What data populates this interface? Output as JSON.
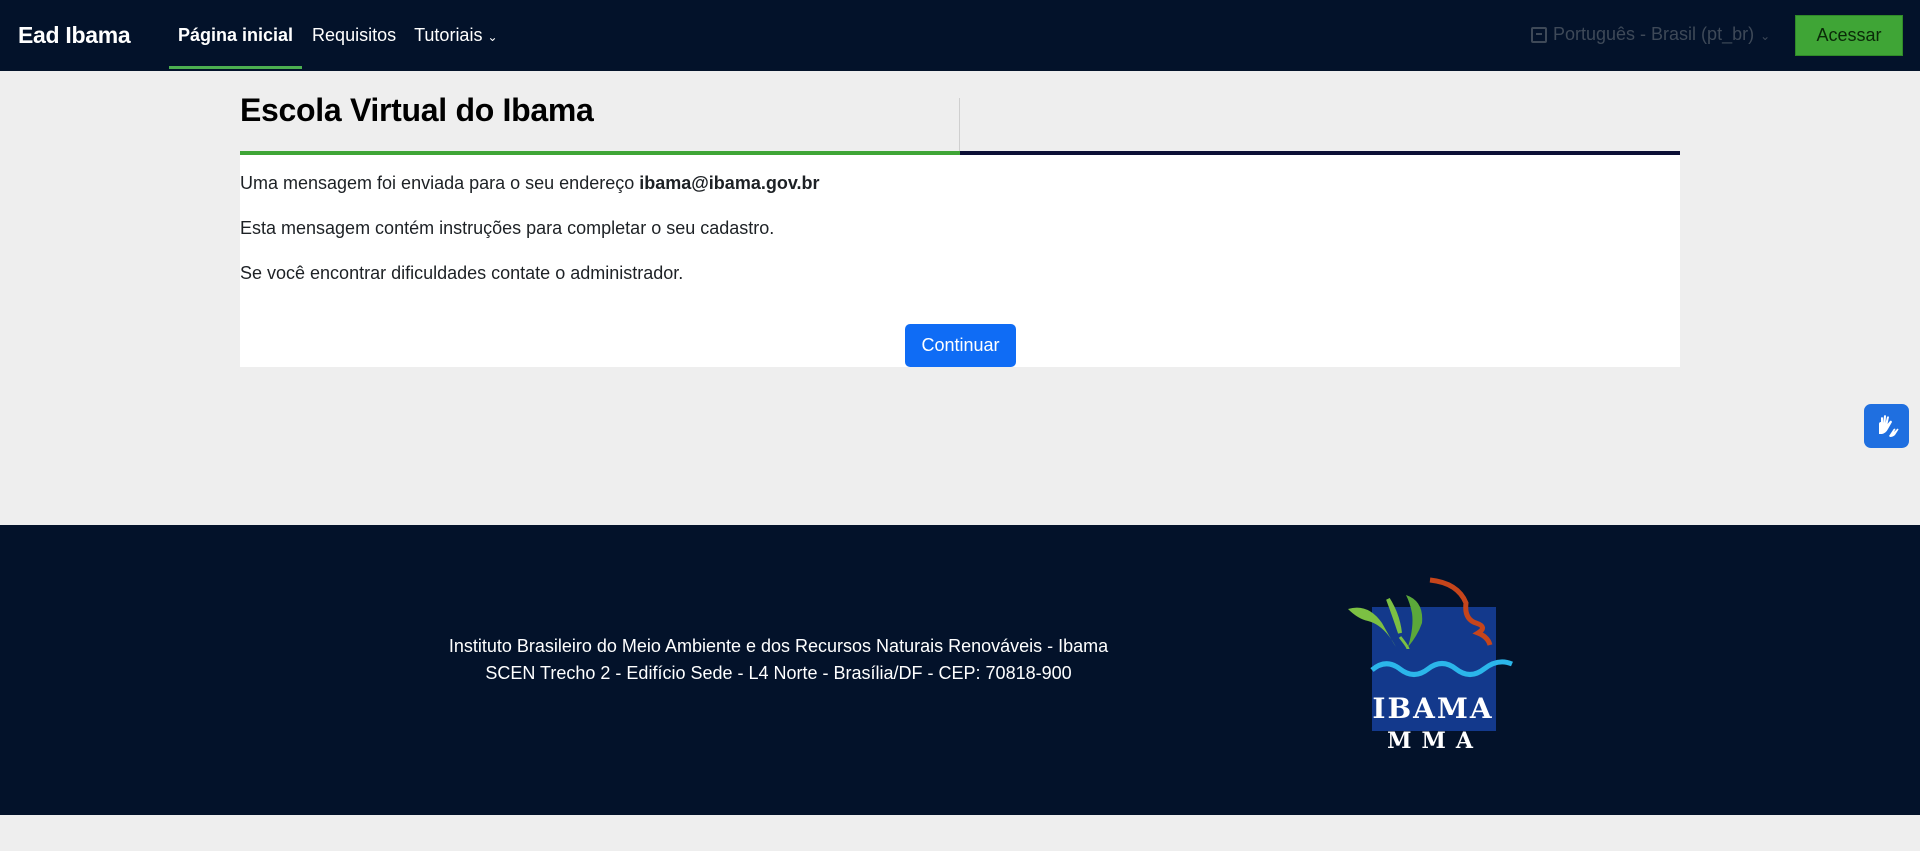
{
  "navbar": {
    "brand": "Ead Ibama",
    "items": [
      {
        "label": "Página inicial",
        "active": true
      },
      {
        "label": "Requisitos"
      },
      {
        "label": "Tutoriais",
        "has_dropdown": true
      }
    ],
    "language": "Português - Brasil (pt_br)",
    "login_label": "Acessar",
    "login_color": "#3fa536"
  },
  "page": {
    "title": "Escola Virtual do Ibama",
    "messages": [
      {
        "text": "Uma mensagem foi enviada para o seu endereço ",
        "email": "ibama@ibama.gov.br"
      },
      {
        "text": "Esta mensagem contém instruções para completar o seu cadastro."
      },
      {
        "text": "Se você encontrar dificuldades contate o administrador."
      }
    ],
    "continue_label": "Continuar",
    "continue_color": "#0f6cf5"
  },
  "accessibility_widget": {
    "icon": "sign-language-hands-icon"
  },
  "footer": {
    "lines": [
      "Instituto Brasileiro do Meio Ambiente e dos Recursos Naturais Renováveis - Ibama",
      "SCEN Trecho 2 - Edifício Sede - L4 Norte - Brasília/DF - CEP: 70818-900"
    ],
    "logo": {
      "line1": "IBAMA",
      "line2": "MMA"
    },
    "background": "#03122a"
  }
}
